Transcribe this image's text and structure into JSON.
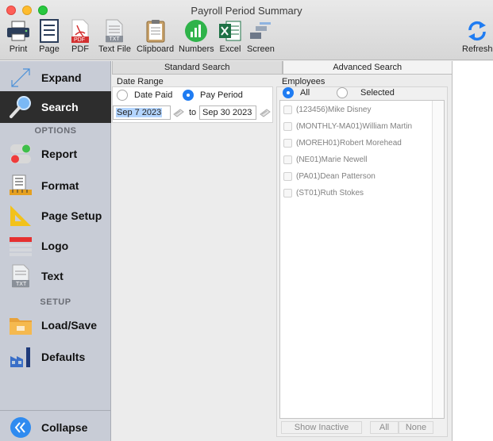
{
  "window": {
    "title": "Payroll Period Summary"
  },
  "toolbar": {
    "items": [
      {
        "label": "Print",
        "icon": "printer-icon"
      },
      {
        "label": "Page",
        "icon": "page-icon"
      },
      {
        "label": "PDF",
        "icon": "pdf-icon",
        "badge": "PDF"
      },
      {
        "label": "Text File",
        "icon": "text-file-icon",
        "badge": "TXT"
      },
      {
        "label": "Clipboard",
        "icon": "clipboard-icon"
      },
      {
        "label": "Numbers",
        "icon": "numbers-icon"
      },
      {
        "label": "Excel",
        "icon": "excel-icon"
      },
      {
        "label": "Screen",
        "icon": "screen-icon"
      }
    ],
    "refresh_label": "Refresh"
  },
  "sidebar": {
    "expand": "Expand",
    "search": "Search",
    "options_header": "OPTIONS",
    "report": "Report",
    "format": "Format",
    "page_setup": "Page Setup",
    "logo": "Logo",
    "text": "Text",
    "text_badge": "TXT",
    "setup_header": "SETUP",
    "load_save": "Load/Save",
    "defaults": "Defaults",
    "collapse": "Collapse"
  },
  "tabs": {
    "standard": "Standard Search",
    "advanced": "Advanced Search"
  },
  "date_range": {
    "label": "Date Range",
    "option_paid": "Date Paid",
    "option_period": "Pay Period",
    "selected": "Pay Period",
    "from": "Sep 7 2023",
    "to_label": "to",
    "to": "Sep 30 2023"
  },
  "employees": {
    "label": "Employees",
    "option_all": "All",
    "option_selected": "Selected",
    "selected": "All",
    "list": [
      "(123456)Mike Disney",
      "(MONTHLY-MA01)William Martin",
      "(MOREH01)Robert Morehead",
      "(NE01)Marie Newell",
      "(PA01)Dean Patterson",
      "(ST01)Ruth Stokes"
    ],
    "show_inactive": "Show Inactive",
    "all_button": "All",
    "none_button": "None"
  },
  "colors": {
    "accent": "#1f7cf2",
    "sidebar": "#c8ccd6",
    "active": "#2d2d2d"
  }
}
